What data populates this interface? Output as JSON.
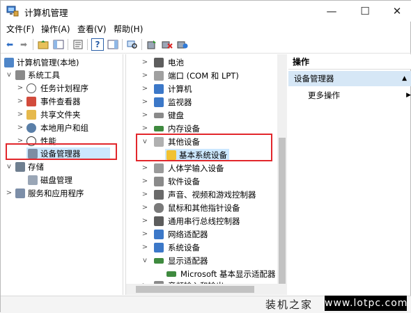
{
  "window": {
    "title": "计算机管理"
  },
  "menu": [
    "文件(F)",
    "操作(A)",
    "查看(V)",
    "帮助(H)"
  ],
  "left_tree": [
    {
      "label": "计算机管理(本地)",
      "icon": "computer-management-icon",
      "indent": 0,
      "twisty": ""
    },
    {
      "label": "系统工具",
      "icon": "system-tools-icon",
      "indent": 1,
      "twisty": "v"
    },
    {
      "label": "任务计划程序",
      "icon": "clock-icon",
      "indent": 2,
      "twisty": ">"
    },
    {
      "label": "事件查看器",
      "icon": "event-viewer-icon",
      "indent": 2,
      "twisty": ">"
    },
    {
      "label": "共享文件夹",
      "icon": "shared-folder-icon",
      "indent": 2,
      "twisty": ">"
    },
    {
      "label": "本地用户和组",
      "icon": "users-icon",
      "indent": 2,
      "twisty": ">"
    },
    {
      "label": "性能",
      "icon": "performance-icon",
      "indent": 2,
      "twisty": ">"
    },
    {
      "label": "设备管理器",
      "icon": "device-manager-icon",
      "indent": 2,
      "twisty": ""
    },
    {
      "label": "存储",
      "icon": "storage-icon",
      "indent": 1,
      "twisty": "v"
    },
    {
      "label": "磁盘管理",
      "icon": "disk-icon",
      "indent": 2,
      "twisty": ""
    },
    {
      "label": "服务和应用程序",
      "icon": "services-icon",
      "indent": 1,
      "twisty": ">"
    }
  ],
  "device_tree": [
    {
      "label": "电池",
      "icon": "battery-icon",
      "twisty": ">"
    },
    {
      "label": "端口 (COM 和 LPT)",
      "icon": "port-icon",
      "twisty": ">"
    },
    {
      "label": "计算机",
      "icon": "computer-icon",
      "twisty": ">"
    },
    {
      "label": "监视器",
      "icon": "monitor-icon",
      "twisty": ">"
    },
    {
      "label": "键盘",
      "icon": "keyboard-icon",
      "twisty": ">"
    },
    {
      "label": "内存设备",
      "icon": "memory-icon",
      "twisty": ">"
    },
    {
      "label": "其他设备",
      "icon": "other-devices-icon",
      "twisty": "v"
    },
    {
      "label": "基本系统设备",
      "icon": "warning-device-icon",
      "twisty": ""
    },
    {
      "label": "人体学输入设备",
      "icon": "hid-icon",
      "twisty": ">"
    },
    {
      "label": "软件设备",
      "icon": "software-device-icon",
      "twisty": ">"
    },
    {
      "label": "声音、视频和游戏控制器",
      "icon": "sound-icon",
      "twisty": ">"
    },
    {
      "label": "鼠标和其他指针设备",
      "icon": "mouse-icon",
      "twisty": ">"
    },
    {
      "label": "通用串行总线控制器",
      "icon": "usb-icon",
      "twisty": ">"
    },
    {
      "label": "网络适配器",
      "icon": "network-icon",
      "twisty": ">"
    },
    {
      "label": "系统设备",
      "icon": "system-device-icon",
      "twisty": ">"
    },
    {
      "label": "显示适配器",
      "icon": "display-adapter-icon",
      "twisty": "v"
    },
    {
      "label": "Microsoft 基本显示适配器",
      "icon": "display-adapter-icon",
      "twisty": ""
    },
    {
      "label": "音频输入和输出",
      "icon": "audio-icon",
      "twisty": ">"
    }
  ],
  "actions": {
    "header": "操作",
    "section": "设备管理器",
    "more": "更多操作"
  },
  "watermark": {
    "cn": "装机之家",
    "url": "www.lotpc.com"
  },
  "colors": {
    "highlight": "#cce8ff",
    "red_box": "#e2262b",
    "action_section": "#d6e7f6"
  }
}
